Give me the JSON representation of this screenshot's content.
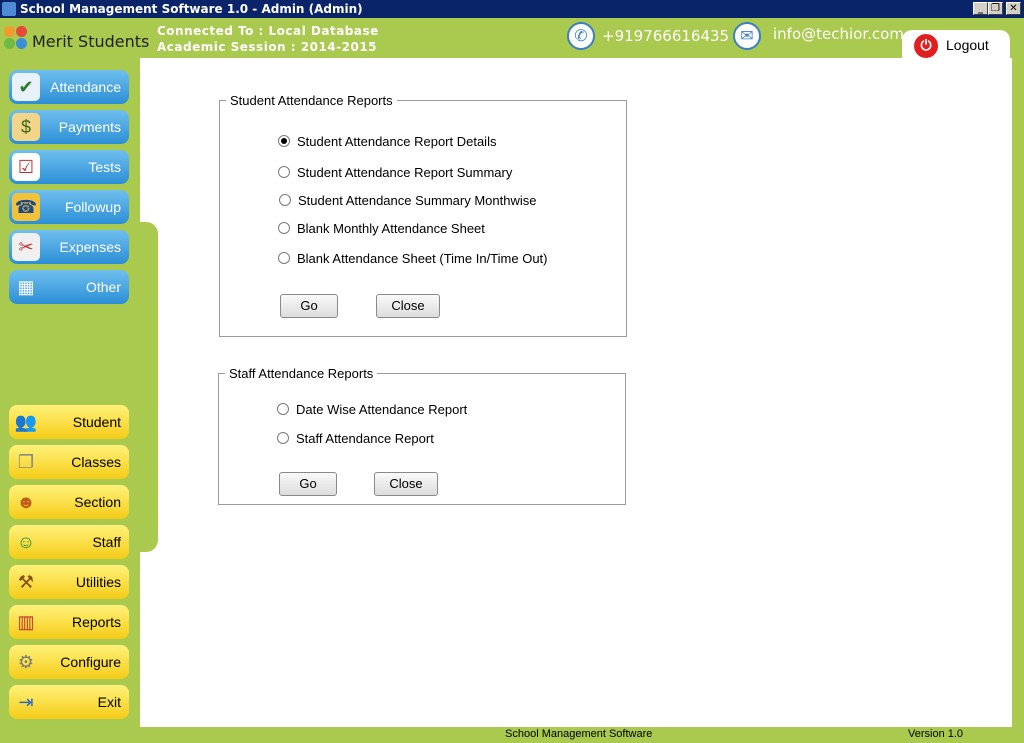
{
  "window": {
    "title": "School Management Software 1.0  -  Admin (Admin)",
    "controls": {
      "minimize": "_",
      "restore": "❐",
      "close": "✕"
    }
  },
  "header": {
    "logo_text": "Merit Students",
    "connection": "Connected To : Local Database",
    "session": "Academic Session : 2014-2015",
    "phone": "+919766616435",
    "email": "info@techior.com",
    "logout_label": "Logout"
  },
  "sidebar": {
    "top_items": [
      {
        "label": "Attendance",
        "icon": "attendance-icon"
      },
      {
        "label": "Payments",
        "icon": "payments-icon"
      },
      {
        "label": "Tests",
        "icon": "tests-icon"
      },
      {
        "label": "Followup",
        "icon": "phone-icon"
      },
      {
        "label": "Expenses",
        "icon": "expenses-icon"
      },
      {
        "label": "Other",
        "icon": "grid-icon"
      }
    ],
    "bottom_items": [
      {
        "label": "Student",
        "icon": "student-icon"
      },
      {
        "label": "Classes",
        "icon": "classes-icon"
      },
      {
        "label": "Section",
        "icon": "section-icon"
      },
      {
        "label": "Staff",
        "icon": "staff-icon"
      },
      {
        "label": "Utilities",
        "icon": "utilities-icon"
      },
      {
        "label": "Reports",
        "icon": "reports-icon"
      },
      {
        "label": "Configure",
        "icon": "gear-icon"
      },
      {
        "label": "Exit",
        "icon": "exit-icon"
      }
    ]
  },
  "student_reports": {
    "legend": "Student Attendance Reports",
    "options": [
      {
        "label": "Student Attendance Report Details",
        "selected": true
      },
      {
        "label": "Student Attendance Report Summary",
        "selected": false
      },
      {
        "label": "Student Attendance Summary Monthwise",
        "selected": false
      },
      {
        "label": "Blank Monthly Attendance Sheet",
        "selected": false
      },
      {
        "label": "Blank Attendance Sheet (Time In/Time Out)",
        "selected": false
      }
    ],
    "go_label": "Go",
    "close_label": "Close"
  },
  "staff_reports": {
    "legend": "Staff Attendance Reports",
    "options": [
      {
        "label": "Date Wise Attendance Report",
        "selected": false
      },
      {
        "label": "Staff Attendance Report",
        "selected": false
      }
    ],
    "go_label": "Go",
    "close_label": "Close"
  },
  "status_bar": {
    "app_name": "School Management Software",
    "version": "Version 1.0"
  },
  "colors": {
    "chrome_green": "#a9c94f",
    "titlebar_blue": "#0a246a",
    "nav_blue": "#2b8fd6",
    "nav_yellow": "#f5cc17",
    "logout_red": "#e02020"
  }
}
